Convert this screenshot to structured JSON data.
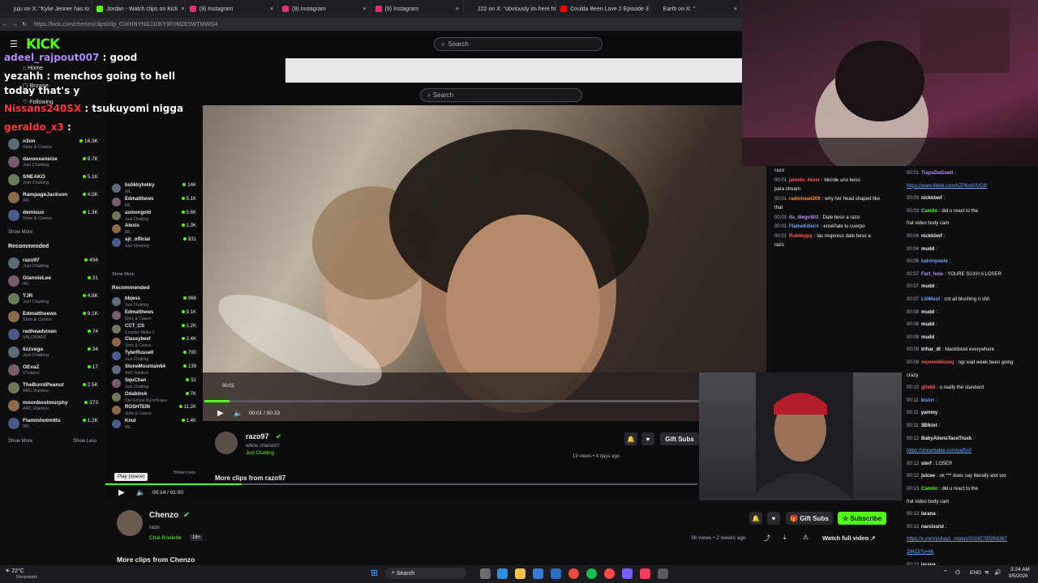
{
  "browser": {
    "tabs": [
      {
        "label": "juju on X: \"Kylie Jenner has to",
        "color": "#1d1d1f"
      },
      {
        "label": "Jordan - Watch clips on Kick",
        "color": "#53fc18"
      },
      {
        "label": "(9) Instagram",
        "color": "#e1306c"
      },
      {
        "label": "(9) Instagram",
        "color": "#e1306c"
      },
      {
        "label": "(9) Instagram",
        "color": "#e1306c"
      },
      {
        "label": "222 on X: \"obviously im here http",
        "color": "#1d1d1f"
      },
      {
        "label": "Coulda Been Love 2 Episode 3: B",
        "color": "#ff0000"
      },
      {
        "label": "Earth on X: \"",
        "color": "#1d1d1f"
      }
    ],
    "url": "https://kick.com/chenzo/clips/clip_01KHNYNGJ10KY9F0M2E5WTMWG4"
  },
  "header": {
    "logo": "KICK",
    "search_placeholder": "Search"
  },
  "inner": {
    "search_placeholder": "Search",
    "nav": [
      "Home",
      "Browse",
      "Following"
    ]
  },
  "overlay_chat": [
    {
      "user": "adeel_rajpout007",
      "msg": " : good",
      "color": "#b58cff"
    },
    {
      "user": "yezahh",
      "msg": " : menchos going to hell",
      "color": "#ffffff"
    },
    {
      "user": "",
      "msg": "today that's y",
      "color": "#ffffff"
    },
    {
      "user": "Nissans240SX",
      "msg": " : tsukuyomi nigga",
      "color": "#ff3b3b"
    },
    {
      "user": "geraldo_x3",
      "msg": " : ",
      "color": "#ff3b3b"
    }
  ],
  "sidebar": {
    "following": [
      {
        "name": "n3on",
        "cat": "Slots & Casino",
        "views": "16.3K"
      },
      {
        "name": "davooxeneize",
        "cat": "Just Chatting",
        "views": "9.7K"
      },
      {
        "name": "SNEAKO",
        "cat": "Just Chatting",
        "views": "5.1K"
      },
      {
        "name": "RampageJackson",
        "cat": "IRL",
        "views": "4.5K"
      },
      {
        "name": "demisux",
        "cat": "Slots & Casino",
        "views": "1.3K"
      }
    ],
    "show_more": "Show More",
    "show_less": "Show Less",
    "recommended_title": "Recommended",
    "recommended": [
      {
        "name": "razo97",
        "cat": "Just Chatting",
        "views": "456"
      },
      {
        "name": "GlannieLee",
        "cat": "IRL",
        "views": "31"
      },
      {
        "name": "TJR",
        "cat": "Just Chatting",
        "views": "4.8K"
      },
      {
        "name": "Edmattheews",
        "cat": "Slots & Casino",
        "views": "9.1K"
      },
      {
        "name": "redheadvixen",
        "cat": "VALORANT",
        "views": "74"
      },
      {
        "name": "lizzvega",
        "cat": "Just Chatting",
        "views": "34"
      },
      {
        "name": "OEvaZ",
        "cat": "VTubers",
        "views": "17"
      },
      {
        "name": "TheBurntPeanut",
        "cat": "ARC Raiders",
        "views": "2.5K"
      },
      {
        "name": "moonbootmurphy",
        "cat": "ARC Raiders",
        "views": "373"
      },
      {
        "name": "Flaminhotmitts",
        "cat": "IRL",
        "views": "1.2K"
      }
    ]
  },
  "inner_sidebar": {
    "following": [
      {
        "name": "bstikkytokky",
        "cat": "IRL",
        "views": "14K"
      },
      {
        "name": "Edmatthews",
        "cat": "IRL",
        "views": "5.1K"
      },
      {
        "name": "asmongold",
        "cat": "Just Chatting",
        "views": "5.6K"
      },
      {
        "name": "Alexis",
        "cat": "IRL",
        "views": "1.3K"
      },
      {
        "name": "sjc_official",
        "cat": "Just Sleeping",
        "views": "831"
      }
    ],
    "recommended": [
      {
        "name": "bbjess",
        "cat": "Just Chatting",
        "views": "966"
      },
      {
        "name": "Edmatthews",
        "cat": "Slots & Casino",
        "views": "9.1K"
      },
      {
        "name": "CCT_CS",
        "cat": "Counter-Strike 2",
        "views": "1.2K"
      },
      {
        "name": "Classybeef",
        "cat": "Slots & Casino",
        "views": "2.4K"
      },
      {
        "name": "TylerRussell",
        "cat": "Just Chatting",
        "views": "790"
      },
      {
        "name": "StoneMountain64",
        "cat": "ARC Raiders",
        "views": "139"
      },
      {
        "name": "SquChan",
        "cat": "Just Chatting",
        "views": "51"
      },
      {
        "name": "Odablock",
        "cat": "Old School RuneScape",
        "views": "7K"
      },
      {
        "name": "ROSHTEIN",
        "cat": "Slots & Casino",
        "views": "11.2K"
      },
      {
        "name": "Knut",
        "cat": "IRL",
        "views": "1.4K"
      }
    ]
  },
  "player": {
    "time_current_inner": "00:01 / 00:23",
    "timestamp_tip": "00:01",
    "progress_inner": 0.05,
    "time_outer": "00:14 / 01:00",
    "progress_outer": 0.23,
    "play_tooltip": "Play (space)"
  },
  "clip_inner": {
    "channel": "razo97",
    "title": "whos chenzo?",
    "category": "Just Chatting",
    "stats": "19 views • 4 days ago",
    "more": "More clips from razo97",
    "gift": "Gift Subs"
  },
  "clip": {
    "channel": "Chenzo",
    "title": "razo",
    "category": "Chat Roulette",
    "age_badge": "18+",
    "stats": "36 views • 2 weeks ago",
    "gift": "Gift Subs",
    "subscribe": "Subscribe",
    "watch_full": "Watch full video",
    "more": "More clips from Chenzo"
  },
  "chat_mid": [
    {
      "ts": "",
      "user": "razo",
      "msg": "",
      "color": "#adadb8"
    },
    {
      "ts": "00:01",
      "user": "jamelo_4ever",
      "msg": ": blonde uno beso",
      "color": "#ff5a5a"
    },
    {
      "ts": "",
      "user": "",
      "msg": "para stream",
      "color": "#efeff1"
    },
    {
      "ts": "00:01",
      "user": "radiohead209",
      "msg": ": why her head shaped like",
      "color": "#ff8a3d"
    },
    {
      "ts": "",
      "user": "",
      "msg": "that",
      "color": "#efeff1"
    },
    {
      "ts": "00:01",
      "user": "its_diego503",
      "msg": ": Dale beso a razo",
      "color": "#b58cff"
    },
    {
      "ts": "00:01",
      "user": "FlameKillerrr",
      "msg": ": enséñale tu cuerpo",
      "color": "#6ea8ff"
    },
    {
      "ts": "00:01",
      "user": "Rubileppy",
      "msg": ": las mujeress dale beso a",
      "color": "#ff5a5a"
    },
    {
      "ts": "",
      "user": "",
      "msg": "razo",
      "color": "#efeff1"
    }
  ],
  "chat_right": [
    {
      "ts": "00:01",
      "user": "TrapsDaGoatt",
      "msg": ":",
      "color": "#b58cff"
    },
    {
      "ts": "",
      "user": "",
      "msg": "https://www.tiktok.com/t/ZP8xdVUC8/",
      "color": "#6ea8ff",
      "link": true
    },
    {
      "ts": "00:03",
      "user": "nickkbwf",
      "msg": ":",
      "color": "#efeff1"
    },
    {
      "ts": "00:03",
      "user": "Camilo",
      "msg": ": did u react to the",
      "color": "#53fc18"
    },
    {
      "ts": "",
      "user": "",
      "msg": "frat video body cam",
      "color": "#efeff1"
    },
    {
      "ts": "00:04",
      "user": "nickkbwf",
      "msg": ":",
      "color": "#efeff1"
    },
    {
      "ts": "00:04",
      "user": "mudd",
      "msg": ":",
      "color": "#efeff1"
    },
    {
      "ts": "00:06",
      "user": "kalvinpaste",
      "msg": ":",
      "color": "#6ea8ff"
    },
    {
      "ts": "00:07",
      "user": "Fart_hole",
      "msg": ": YOURE SUXH A LOSER",
      "color": "#b58cff"
    },
    {
      "ts": "00:07",
      "user": "mudd",
      "msg": ":",
      "color": "#efeff1"
    },
    {
      "ts": "00:07",
      "user": "LiliMoot",
      "msg": ": cnt all blushing n shit",
      "color": "#6ea8ff"
    },
    {
      "ts": "00:08",
      "user": "mudd",
      "msg": ":",
      "color": "#efeff1"
    },
    {
      "ts": "00:08",
      "user": "mudd",
      "msg": ":",
      "color": "#efeff1"
    },
    {
      "ts": "00:09",
      "user": "mudd",
      "msg": ":",
      "color": "#efeff1"
    },
    {
      "ts": "00:09",
      "user": "Irihar_dt",
      "msg": ": blacklisted everywhere",
      "color": "#efeff1"
    },
    {
      "ts": "00:09",
      "user": "mommiilloveq",
      "msg": ": ngl wad week been going",
      "color": "#ff5a5a"
    },
    {
      "ts": "",
      "user": "",
      "msg": "crazy",
      "color": "#efeff1"
    },
    {
      "ts": "00:10",
      "user": "gfie88",
      "msg": ": u really the standard",
      "color": "#ff5a5a"
    },
    {
      "ts": "00:11",
      "user": "bisiirr",
      "msg": ":",
      "color": "#6ea8ff"
    },
    {
      "ts": "00:11",
      "user": "yammy",
      "msg": ":",
      "color": "#efeff1"
    },
    {
      "ts": "00:11",
      "user": "3Blklot",
      "msg": ":",
      "color": "#efeff1"
    },
    {
      "ts": "00:12",
      "user": "BabyAliensTacoTruck",
      "msg": ":",
      "color": "#efeff1"
    },
    {
      "ts": "",
      "user": "",
      "msg": "https://streamable.com/yaf5s0",
      "color": "#6ea8ff",
      "link": true
    },
    {
      "ts": "00:12",
      "user": "slerf",
      "msg": ": LOSER",
      "color": "#efeff1"
    },
    {
      "ts": "00:12",
      "user": "juicee",
      "msg": ": ok *** does say literally alot too",
      "color": "#efeff1"
    },
    {
      "ts": "00:13",
      "user": "Camilo",
      "msg": ": did u react to the",
      "color": "#53fc18"
    },
    {
      "ts": "",
      "user": "",
      "msg": "frat video body cam",
      "color": "#efeff1"
    },
    {
      "ts": "00:13",
      "user": "larana",
      "msg": ":",
      "color": "#efeff1"
    },
    {
      "ts": "00:13",
      "user": "narcissist",
      "msg": ":",
      "color": "#efeff1"
    },
    {
      "ts": "",
      "user": "",
      "msg": "https://x.com/yslrayz_/status/20242785058367",
      "color": "#6ea8ff",
      "link": true
    },
    {
      "ts": "",
      "user": "",
      "msg": "28415?s=46",
      "color": "#6ea8ff",
      "link": true
    },
    {
      "ts": "00:13",
      "user": "larana",
      "msg": ":",
      "color": "#efeff1"
    },
    {
      "ts": "00:13",
      "user": "larana",
      "msg": ":",
      "color": "#efeff1"
    }
  ],
  "taskbar": {
    "weather_temp": "22°C",
    "weather_desc": "Despejado",
    "search": "Search",
    "lang": "ENG",
    "time": "3:24 AM",
    "date": "9/5/2026"
  },
  "colors": {
    "accent": "#53fc18",
    "background": "#0e0e10"
  }
}
